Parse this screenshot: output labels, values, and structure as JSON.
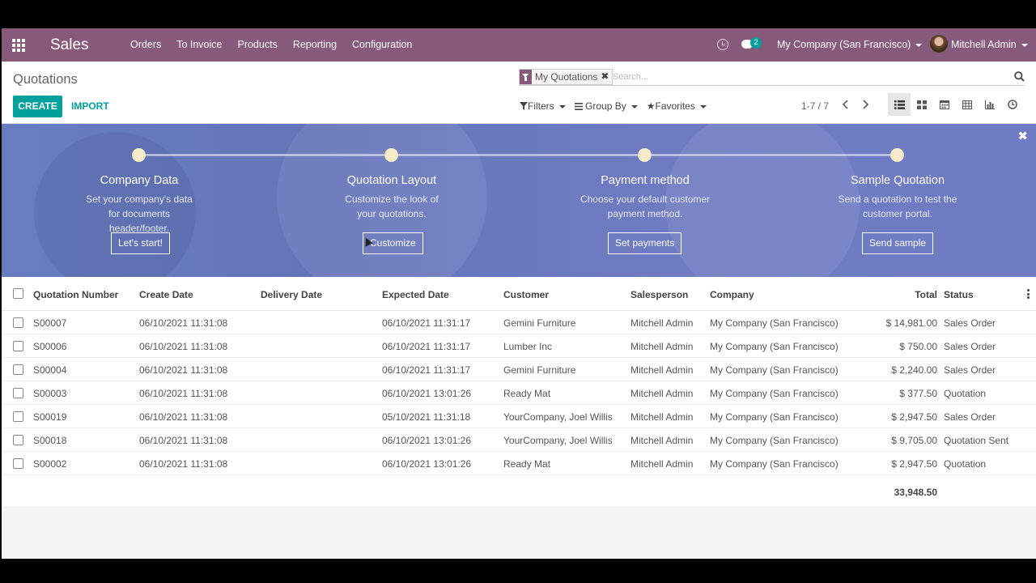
{
  "navbar": {
    "brand": "Sales",
    "menu": [
      "Orders",
      "To Invoice",
      "Products",
      "Reporting",
      "Configuration"
    ],
    "chat_count": "2",
    "company": "My Company (San Francisco)",
    "user": "Mitchell Admin",
    "bg_color": "#875a7b"
  },
  "control_panel": {
    "breadcrumb": "Quotations",
    "create_label": "CREATE",
    "import_label": "IMPORT",
    "facet": "My Quotations",
    "search_placeholder": "Search...",
    "filters_label": "Filters",
    "groupby_label": "Group By",
    "favorites_label": "Favorites",
    "pager": "1-7 / 7",
    "accent_color": "#00a09d"
  },
  "banner": {
    "steps": [
      {
        "title": "Company Data",
        "desc": "Set your company's data for documents header/footer.",
        "button": "Let's start!"
      },
      {
        "title": "Quotation Layout",
        "desc": "Customize the look of your quotations.",
        "button": "Customize"
      },
      {
        "title": "Payment method",
        "desc": "Choose your default customer payment method.",
        "button": "Set payments"
      },
      {
        "title": "Sample Quotation",
        "desc": "Send a quotation to test the customer portal.",
        "button": "Send sample"
      }
    ]
  },
  "table": {
    "headers": {
      "number": "Quotation Number",
      "create_date": "Create Date",
      "delivery_date": "Delivery Date",
      "expected_date": "Expected Date",
      "customer": "Customer",
      "salesperson": "Salesperson",
      "company": "Company",
      "total": "Total",
      "status": "Status"
    },
    "rows": [
      {
        "number": "S00007",
        "create_date": "06/10/2021 11:31:08",
        "delivery_date": "",
        "expected_date": "06/10/2021 11:31:17",
        "customer": "Gemini Furniture",
        "salesperson": "Mitchell Admin",
        "company": "My Company (San Francisco)",
        "total": "$ 14,981.00",
        "status": "Sales Order"
      },
      {
        "number": "S00006",
        "create_date": "06/10/2021 11:31:08",
        "delivery_date": "",
        "expected_date": "06/10/2021 11:31:17",
        "customer": "Lumber Inc",
        "salesperson": "Mitchell Admin",
        "company": "My Company (San Francisco)",
        "total": "$ 750.00",
        "status": "Sales Order"
      },
      {
        "number": "S00004",
        "create_date": "06/10/2021 11:31:08",
        "delivery_date": "",
        "expected_date": "06/10/2021 11:31:17",
        "customer": "Gemini Furniture",
        "salesperson": "Mitchell Admin",
        "company": "My Company (San Francisco)",
        "total": "$ 2,240.00",
        "status": "Sales Order"
      },
      {
        "number": "S00003",
        "create_date": "06/10/2021 11:31:08",
        "delivery_date": "",
        "expected_date": "06/10/2021 13:01:26",
        "customer": "Ready Mat",
        "salesperson": "Mitchell Admin",
        "company": "My Company (San Francisco)",
        "total": "$ 377.50",
        "status": "Quotation"
      },
      {
        "number": "S00019",
        "create_date": "06/10/2021 11:31:08",
        "delivery_date": "",
        "expected_date": "05/10/2021 11:31:18",
        "customer": "YourCompany, Joel Willis",
        "salesperson": "Mitchell Admin",
        "company": "My Company (San Francisco)",
        "total": "$ 2,947.50",
        "status": "Sales Order"
      },
      {
        "number": "S00018",
        "create_date": "06/10/2021 11:31:08",
        "delivery_date": "",
        "expected_date": "06/10/2021 13:01:26",
        "customer": "YourCompany, Joel Willis",
        "salesperson": "Mitchell Admin",
        "company": "My Company (San Francisco)",
        "total": "$ 9,705.00",
        "status": "Quotation Sent"
      },
      {
        "number": "S00002",
        "create_date": "06/10/2021 11:31:08",
        "delivery_date": "",
        "expected_date": "06/10/2021 13:01:26",
        "customer": "Ready Mat",
        "salesperson": "Mitchell Admin",
        "company": "My Company (San Francisco)",
        "total": "$ 2,947.50",
        "status": "Quotation"
      }
    ],
    "grand_total": "33,948.50"
  }
}
